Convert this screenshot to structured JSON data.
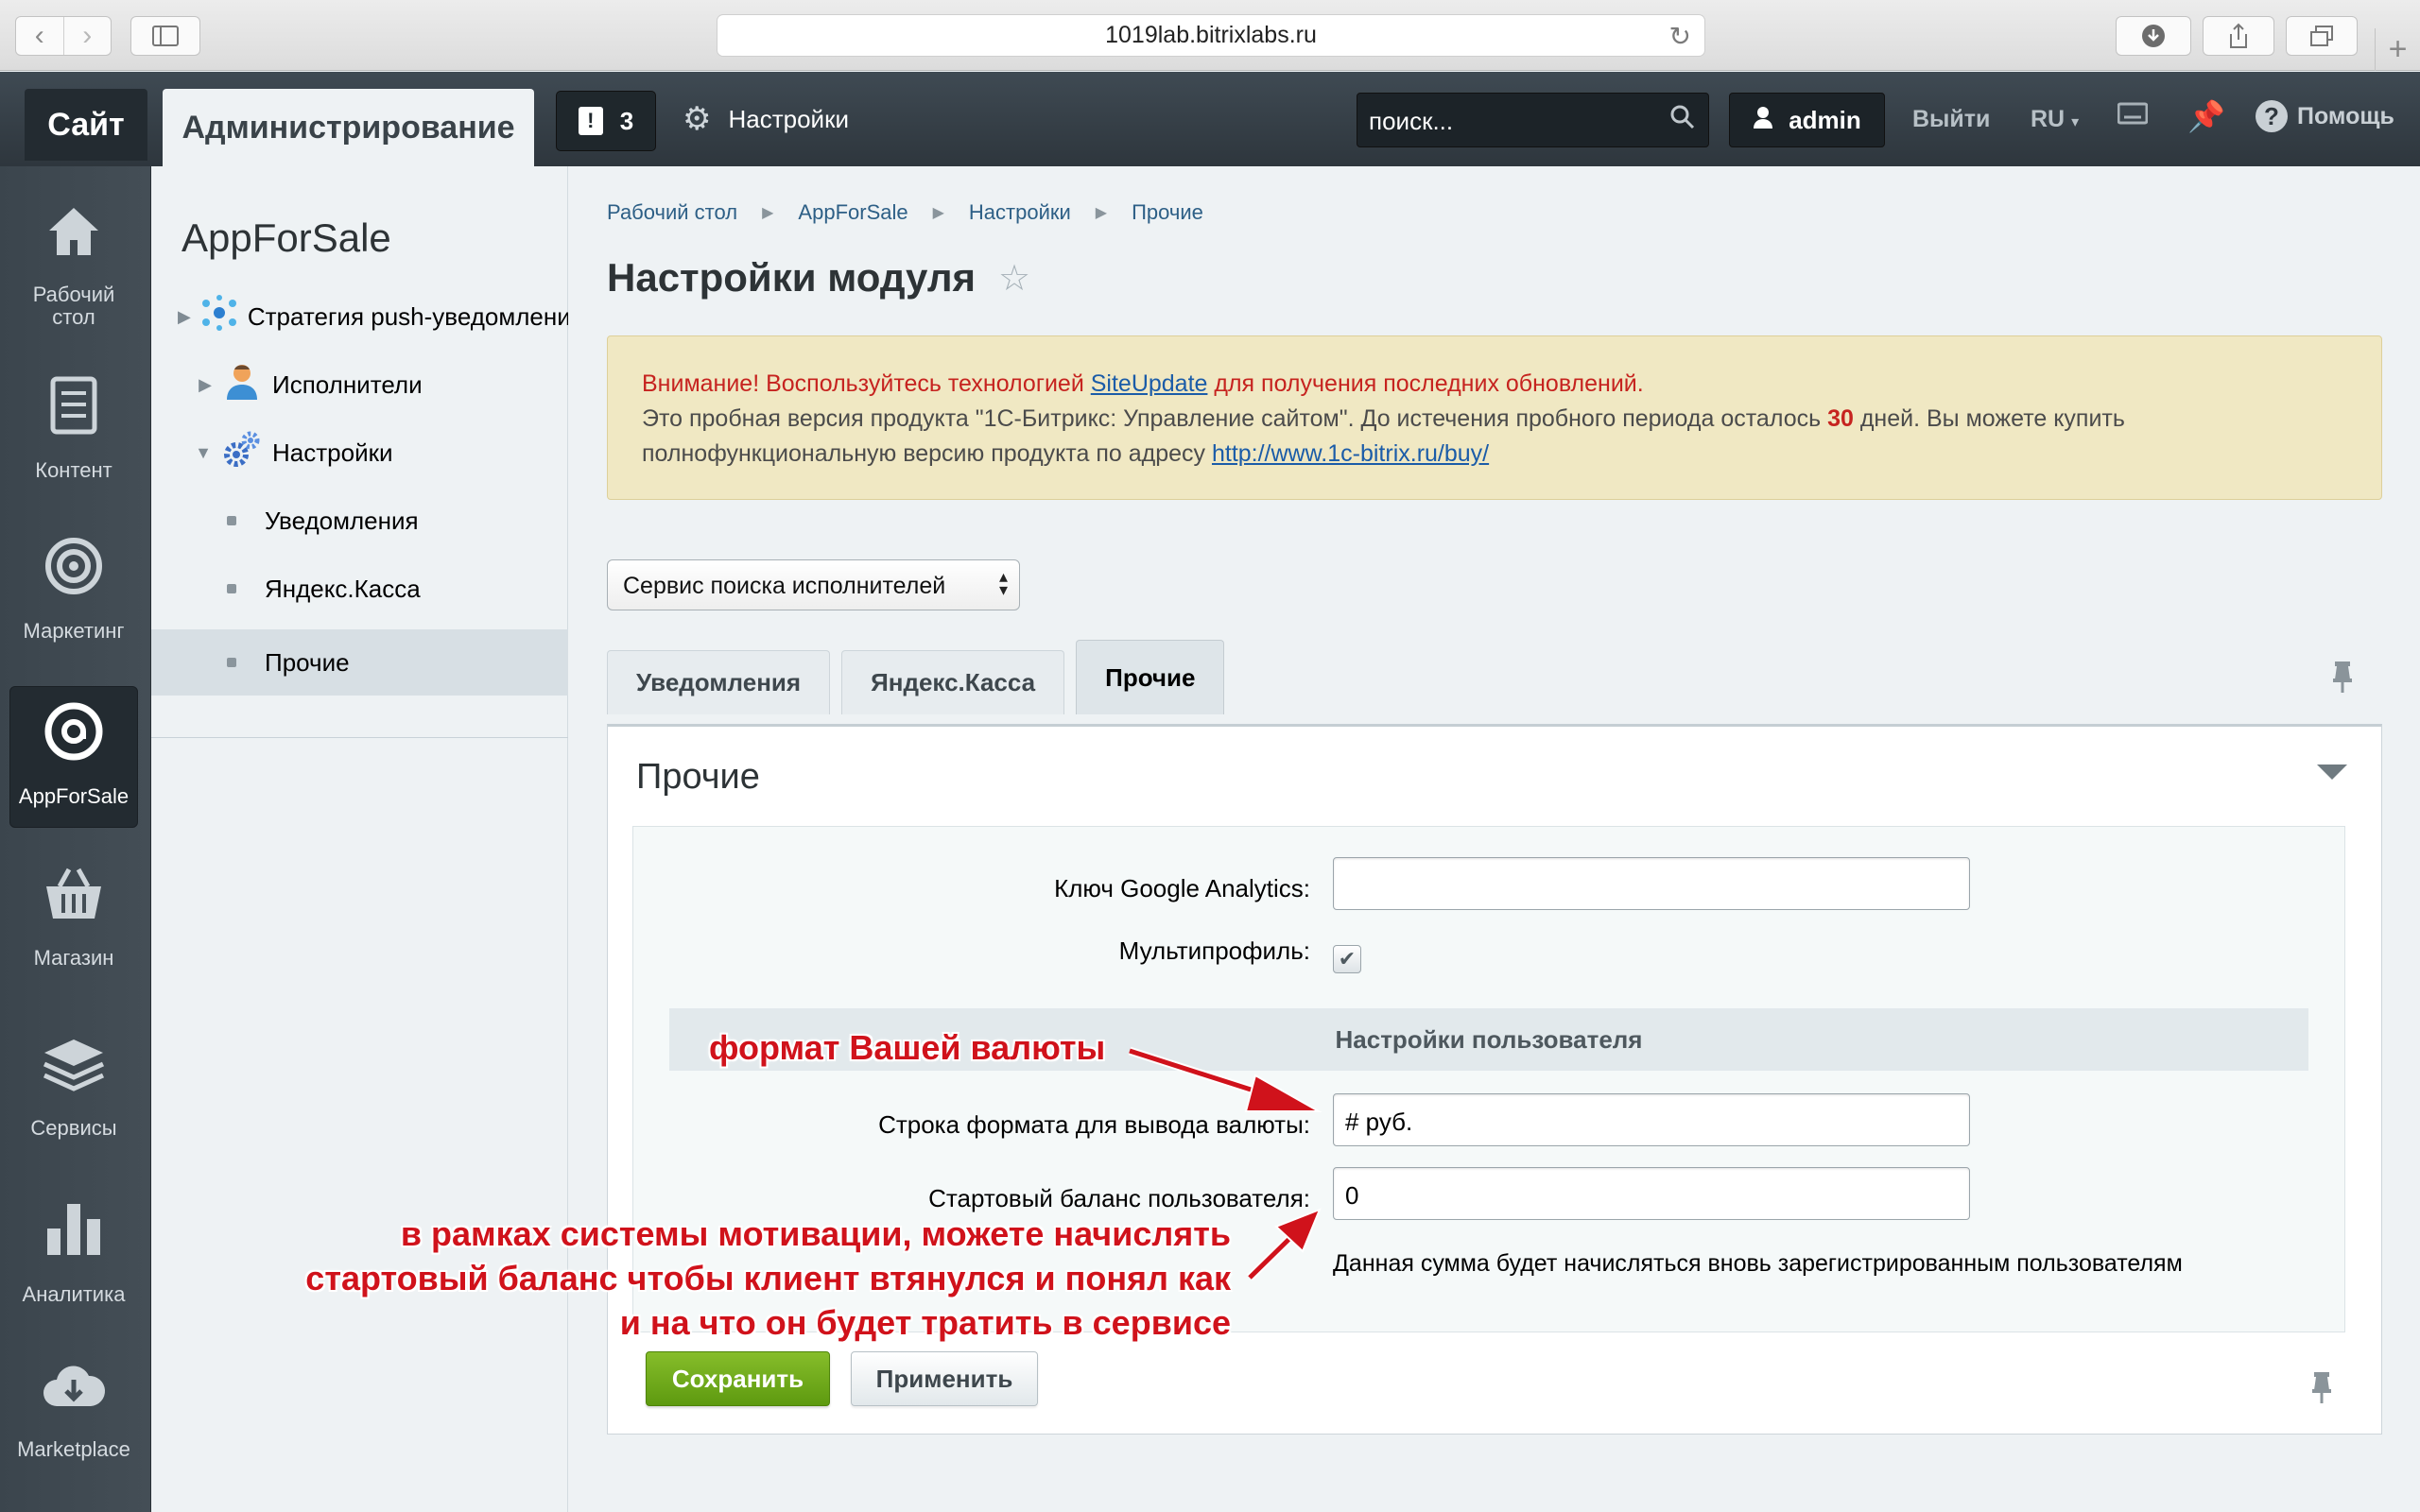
{
  "browser": {
    "url": "1019lab.bitrixlabs.ru"
  },
  "topbar": {
    "site_tab": "Сайт",
    "admin_tab": "Администрирование",
    "notifications_count": "3",
    "settings_label": "Настройки",
    "search_placeholder": "поиск...",
    "user_name": "admin",
    "logout_label": "Выйти",
    "language": "RU",
    "help_label": "Помощь"
  },
  "left_nav": {
    "items": [
      {
        "label": "Рабочий стол",
        "icon": "home-icon"
      },
      {
        "label": "Контент",
        "icon": "document-icon"
      },
      {
        "label": "Маркетинг",
        "icon": "target-icon"
      },
      {
        "label": "AppForSale",
        "icon": "appforsale-icon"
      },
      {
        "label": "Магазин",
        "icon": "basket-icon"
      },
      {
        "label": "Сервисы",
        "icon": "layers-icon"
      },
      {
        "label": "Аналитика",
        "icon": "bar-chart-icon"
      },
      {
        "label": "Marketplace",
        "icon": "cloud-download-icon"
      }
    ]
  },
  "secondary_menu": {
    "title": "AppForSale",
    "items": [
      {
        "label": "Стратегия push-уведомлений",
        "icon": "network-icon"
      },
      {
        "label": "Исполнители",
        "icon": "user-icon"
      },
      {
        "label": "Настройки",
        "icon": "gears-icon"
      },
      {
        "label": "Уведомления"
      },
      {
        "label": "Яндекс.Касса"
      },
      {
        "label": "Прочие"
      }
    ]
  },
  "breadcrumb": [
    "Рабочий стол",
    "AppForSale",
    "Настройки",
    "Прочие"
  ],
  "page_title": "Настройки модуля",
  "alert": {
    "warn_prefix": "Внимание! Воспользуйтесь технологией ",
    "warn_link": "SiteUpdate",
    "warn_suffix": " для получения последних обновлений.",
    "trial_text_1": "Это пробная версия продукта \"1С-Битрикс: Управление сайтом\". До истечения пробного периода осталось ",
    "days": "30",
    "trial_text_2": " дней. Вы можете купить полнофункциональную версию продукта по адресу ",
    "buy_link": "http://www.1c-bitrix.ru/buy/"
  },
  "module_select": {
    "value": "Сервис поиска исполнителей"
  },
  "tabs": [
    "Уведомления",
    "Яндекс.Касса",
    "Прочие"
  ],
  "panel": {
    "title": "Прочие",
    "ga_label": "Ключ Google Analytics:",
    "ga_value": "",
    "multiprofile_label": "Мультипрофиль:",
    "multiprofile_checked": true,
    "user_settings_header": "Настройки пользователя",
    "currency_label": "Строка формата для вывода валюты:",
    "currency_value": "# руб.",
    "balance_label": "Стартовый баланс пользователя:",
    "balance_value": "0",
    "balance_hint": "Данная сумма будет начисляться вновь зарегистрированным пользователям"
  },
  "buttons": {
    "save": "Сохранить",
    "apply": "Применить"
  },
  "annotations": {
    "currency_note": "формат Вашей валюты",
    "balance_note_1": "в рамках системы мотивации, можете начислять",
    "balance_note_2": "стартовый баланс чтобы клиент втянулся и понял как",
    "balance_note_3": "и на что он будет тратить в сервисе",
    "color": "#d0121b"
  }
}
